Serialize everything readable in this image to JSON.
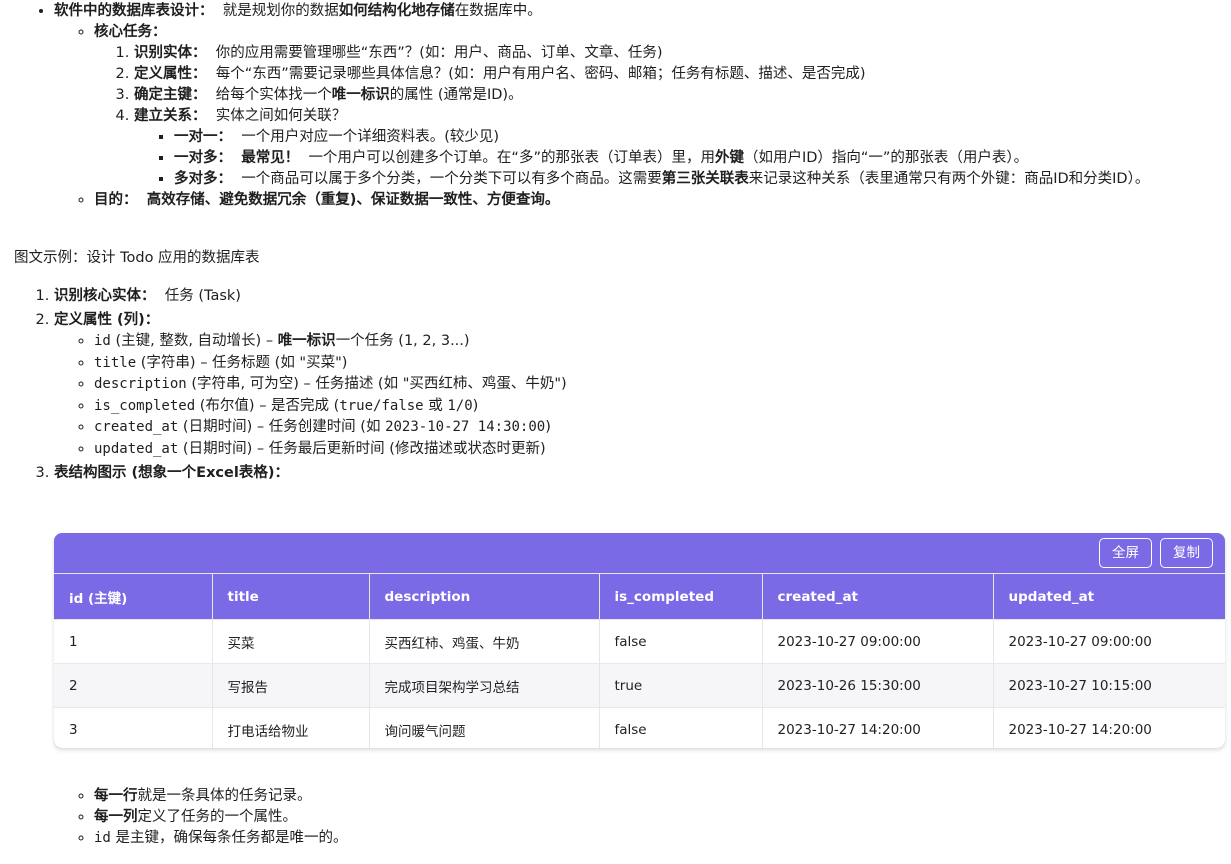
{
  "section1": {
    "title": "软件中的数据库表设计：",
    "desc_pre": "就是规划你的数据",
    "desc_bold": "如何结构化地存储",
    "desc_post": "在数据库中。",
    "core_title": "核心任务：",
    "tasks": [
      {
        "title": "识别实体：",
        "text": "你的应用需要管理哪些“东西”？(如：用户、商品、订单、文章、任务)"
      },
      {
        "title": "定义属性：",
        "text": "每个“东西”需要记录哪些具体信息？(如：用户有用户名、密码、邮箱；任务有标题、描述、是否完成)"
      },
      {
        "title": "确定主键：",
        "text_pre": "给每个实体找一个",
        "text_bold": "唯一标识",
        "text_post": "的属性 (通常是ID)。"
      },
      {
        "title": "建立关系：",
        "text": "实体之间如何关联？"
      }
    ],
    "relations": [
      {
        "title": "一对一：",
        "text": "一个用户对应一个详细资料表。(较少见)"
      },
      {
        "title": "一对多：",
        "bold2": "最常见！",
        "text_pre": "一个用户可以创建多个订单。在“多”的那张表（订单表）里，用",
        "text_bold": "外键",
        "text_post": "（如用户ID）指向“一”的那张表（用户表）。"
      },
      {
        "title": "多对多：",
        "text_pre": "一个商品可以属于多个分类，一个分类下可以有多个商品。这需要",
        "text_bold": "第三张关联表",
        "text_post": "来记录这种关系（表里通常只有两个外键：商品ID和分类ID）。"
      }
    ],
    "goal_title": "目的：",
    "goal_text": "高效存储、避免数据冗余（重复)、保证数据一致性、方便查询。"
  },
  "intro": "图文示例：设计 Todo 应用的数据库表",
  "steps": {
    "s1_title": "识别核心实体：",
    "s1_text": "任务 (Task)",
    "s2_title": "定义属性 (列)：",
    "attrs": [
      {
        "code": "id",
        "pre": " (主键, 整数, 自动增长) – ",
        "bold": "唯一标识",
        "post": "一个任务 (1, 2, 3...)"
      },
      {
        "code": "title",
        "pre": " (字符串) – 任务标题 (如 \"买菜\")"
      },
      {
        "code": "description",
        "pre": " (字符串, 可为空) – 任务描述 (如 \"买西红柿、鸡蛋、牛奶\")"
      },
      {
        "code": "is_completed",
        "pre": " (布尔值) – 是否完成 (",
        "code2": "true/false",
        "mid": " 或 ",
        "code3": "1/0",
        "post": ")"
      },
      {
        "code": "created_at",
        "pre": " (日期时间) – 任务创建时间 (如 ",
        "code2": "2023-10-27 14:30:00",
        "post": ")"
      },
      {
        "code": "updated_at",
        "pre": " (日期时间) – 任务最后更新时间 (修改描述或状态时更新)"
      }
    ],
    "s3_title": "表结构图示 (想象一个Excel表格)："
  },
  "table": {
    "fullscreen_label": "全屏",
    "copy_label": "复制",
    "headers": [
      "id (主键)",
      "title",
      "description",
      "is_completed",
      "created_at",
      "updated_at"
    ],
    "rows": [
      [
        "1",
        "买菜",
        "买西红柿、鸡蛋、牛奶",
        "false",
        "2023-10-27 09:00:00",
        "2023-10-27 09:00:00"
      ],
      [
        "2",
        "写报告",
        "完成项目架构学习总结",
        "true",
        "2023-10-26 15:30:00",
        "2023-10-27 10:15:00"
      ],
      [
        "3",
        "打电话给物业",
        "询问暖气问题",
        "false",
        "2023-10-27 14:20:00",
        "2023-10-27 14:20:00"
      ]
    ]
  },
  "after": [
    {
      "bold": "每一行",
      "text": "就是一条具体的任务记录。"
    },
    {
      "bold": "每一列",
      "text": "定义了任务的一个属性。"
    },
    {
      "code": "id",
      "text": " 是主键，确保每条任务都是唯一的。"
    }
  ]
}
